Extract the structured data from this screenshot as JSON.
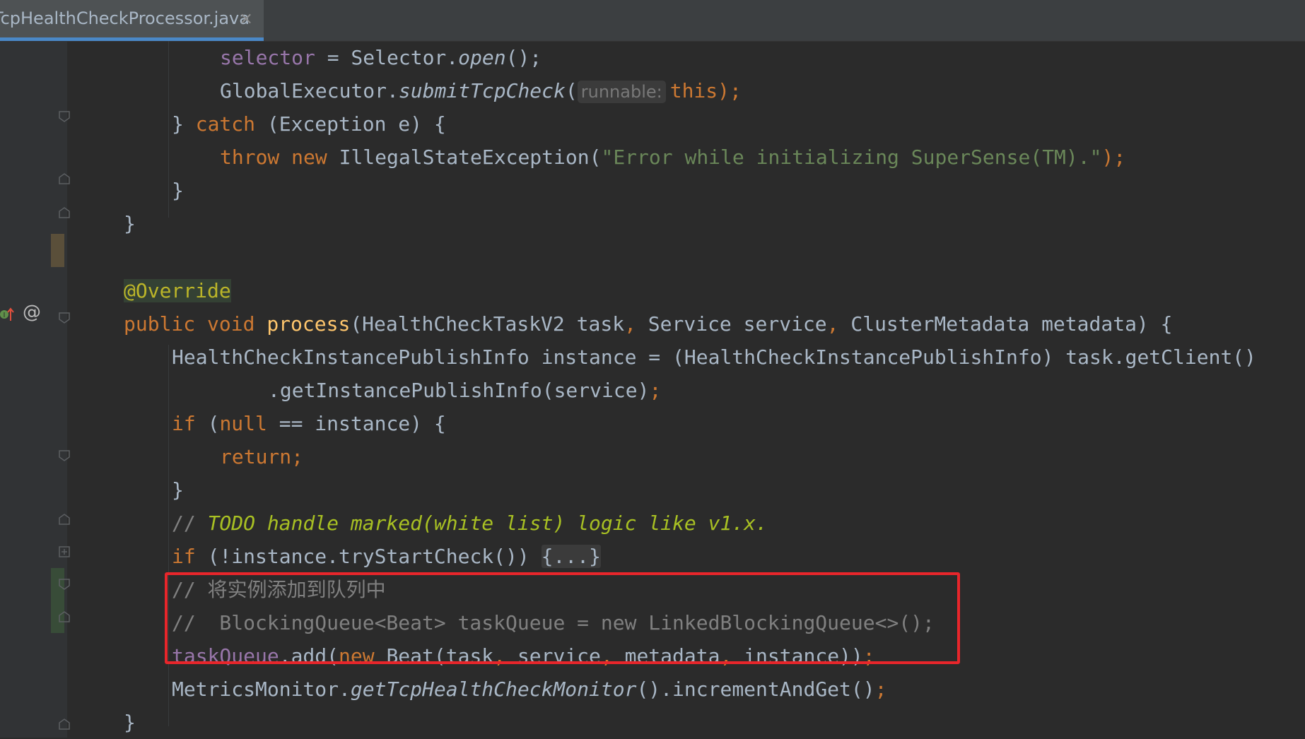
{
  "tab": {
    "filename": "TcpHealthCheckProcessor.java",
    "close_glyph": "×"
  },
  "gutter": {
    "override_icon": "up-arrow-override-icon",
    "annotation_icon": "@"
  },
  "code": {
    "line1": {
      "field": "selector",
      "op": " = Selector.",
      "method": "open",
      "end": "();"
    },
    "line2": {
      "prefix": "GlobalExecutor.",
      "method": "submitTcpCheck",
      "paren": "(",
      "hint": "runnable:",
      "kw": "this",
      "end": ");"
    },
    "line3": {
      "brace": "} ",
      "kw": "catch",
      "rest": " (Exception e) {"
    },
    "line4": {
      "kw1": "throw",
      "kw2": "new",
      "cls": " IllegalStateException(",
      "str": "\"Error while initializing SuperSense(TM).\"",
      "end": ");"
    },
    "line5": {
      "text": "}"
    },
    "line6": {
      "text": "}"
    },
    "line7": {
      "annotation": "@Override"
    },
    "line8": {
      "kw1": "public",
      "kw2": "void",
      "method": "process",
      "p1": "(HealthCheckTaskV2 task",
      "p2": " Service service",
      "p3": " ClusterMetadata metadata) {",
      "comma": ","
    },
    "line9": {
      "text": "HealthCheckInstancePublishInfo instance = (HealthCheckInstancePublishInfo) task.getClient()"
    },
    "line10": {
      "text": ".getInstancePublishInfo(service)",
      "end": ";"
    },
    "line11": {
      "kw": "if",
      "p1": " (",
      "kw2": "null",
      "p2": " == instance) {"
    },
    "line12": {
      "kw": "return",
      "end": ";"
    },
    "line13": {
      "text": "}"
    },
    "line14": {
      "slashes": "// ",
      "todo": "TODO handle marked(white list) logic like v1.x."
    },
    "line15": {
      "kw": "if",
      "rest": " (!instance.tryStartCheck()) ",
      "folded": "{...}"
    },
    "line16": {
      "comment": "// 将实例添加到队列中"
    },
    "line17": {
      "comment": "//  BlockingQueue<Beat> taskQueue = new LinkedBlockingQueue<>();"
    },
    "line18": {
      "field": "taskQueue",
      "p1": ".add(",
      "kw": "new",
      "p2": " Beat(task",
      "p3": " service",
      "p4": " metadata",
      "p5": " instance))",
      "comma": ",",
      "end": ";"
    },
    "line19": {
      "prefix": "MetricsMonitor.",
      "method": "getTcpHealthCheckMonitor",
      "rest": "().incrementAndGet()",
      "end": ";"
    },
    "line20": {
      "text": "}"
    }
  },
  "colors": {
    "background": "#2b2b2b",
    "keyword": "#cc7832",
    "field": "#9876aa",
    "string": "#6a8759",
    "comment": "#808080",
    "todo": "#a8c023",
    "annotation": "#bbb529",
    "highlight_box": "#e8262b",
    "tab_underline": "#4a88c7"
  }
}
